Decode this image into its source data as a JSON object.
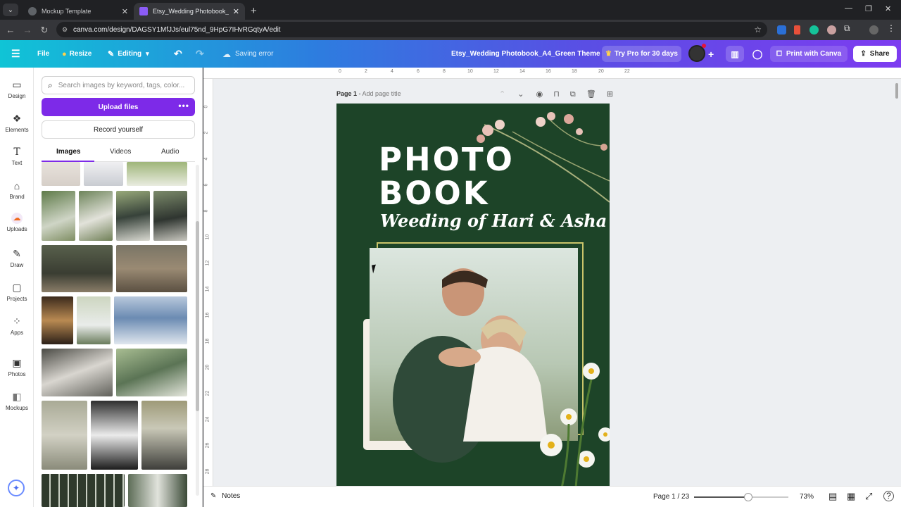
{
  "browser": {
    "tabs": [
      {
        "title": "Mockup Template",
        "active": false
      },
      {
        "title": "Etsy_Wedding Photobook_A4_Green Theme",
        "active": true
      }
    ],
    "url": "canva.com/design/DAGSY1MfJJs/eul75nd_9HpG7IHvRGqtyA/edit"
  },
  "header": {
    "file": "File",
    "resize": "Resize",
    "editing": "Editing",
    "status": "Saving error",
    "doc_title": "Etsy_Wedding Photobook_A4_Green Theme",
    "try_pro": "Try Pro for 30 days",
    "print": "Print with Canva",
    "share": "Share"
  },
  "rail": [
    {
      "label": "Design",
      "icon": "design-icon"
    },
    {
      "label": "Elements",
      "icon": "elements-icon"
    },
    {
      "label": "Text",
      "icon": "text-icon"
    },
    {
      "label": "Brand",
      "icon": "brand-icon"
    },
    {
      "label": "Uploads",
      "icon": "uploads-icon"
    },
    {
      "label": "Draw",
      "icon": "draw-icon"
    },
    {
      "label": "Projects",
      "icon": "projects-icon"
    },
    {
      "label": "Apps",
      "icon": "apps-icon"
    },
    {
      "label": "Photos",
      "icon": "photos-icon"
    },
    {
      "label": "Mockups",
      "icon": "mockups-icon"
    }
  ],
  "panel": {
    "search_placeholder": "Search images by keyword, tags, color...",
    "upload": "Upload files",
    "record": "Record yourself",
    "tabs": [
      "Images",
      "Videos",
      "Audio"
    ]
  },
  "ruler_h": [
    "0",
    "2",
    "4",
    "6",
    "8",
    "10",
    "12",
    "14",
    "16",
    "18",
    "20",
    "22"
  ],
  "ruler_v": [
    "0",
    "2",
    "4",
    "6",
    "8",
    "10",
    "12",
    "14",
    "16",
    "18",
    "20",
    "22",
    "24",
    "26",
    "28"
  ],
  "page": {
    "label": "Page 1",
    "title_placeholder": "Add page title"
  },
  "design": {
    "title_line1": "PHOTO",
    "title_line2": "BOOK",
    "subtitle": "Weeding of Hari & Asha",
    "bg_color": "#1d4428"
  },
  "footer": {
    "notes": "Notes",
    "page_count": "Page 1 / 23",
    "zoom": "73%",
    "zoom_level": 0.73
  }
}
